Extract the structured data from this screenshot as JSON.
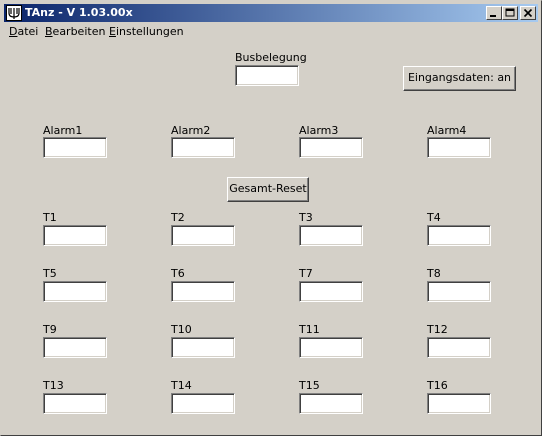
{
  "window": {
    "title": "TAnz - V 1.03.00x",
    "icon": "app-icon"
  },
  "menu": [
    "Datei",
    "Bearbeiten",
    "Einstellungen"
  ],
  "busbelegung": {
    "label": "Busbelegung",
    "value": ""
  },
  "eingangsdaten_button": "Eingangsdaten: an",
  "gesamt_reset_button": "Gesamt-Reset",
  "alarms": [
    {
      "label": "Alarm1",
      "value": ""
    },
    {
      "label": "Alarm2",
      "value": ""
    },
    {
      "label": "Alarm3",
      "value": ""
    },
    {
      "label": "Alarm4",
      "value": ""
    }
  ],
  "temps": [
    {
      "label": "T1",
      "value": ""
    },
    {
      "label": "T2",
      "value": ""
    },
    {
      "label": "T3",
      "value": ""
    },
    {
      "label": "T4",
      "value": ""
    },
    {
      "label": "T5",
      "value": ""
    },
    {
      "label": "T6",
      "value": ""
    },
    {
      "label": "T7",
      "value": ""
    },
    {
      "label": "T8",
      "value": ""
    },
    {
      "label": "T9",
      "value": ""
    },
    {
      "label": "T10",
      "value": ""
    },
    {
      "label": "T11",
      "value": ""
    },
    {
      "label": "T12",
      "value": ""
    },
    {
      "label": "T13",
      "value": ""
    },
    {
      "label": "T14",
      "value": ""
    },
    {
      "label": "T15",
      "value": ""
    },
    {
      "label": "T16",
      "value": ""
    }
  ]
}
